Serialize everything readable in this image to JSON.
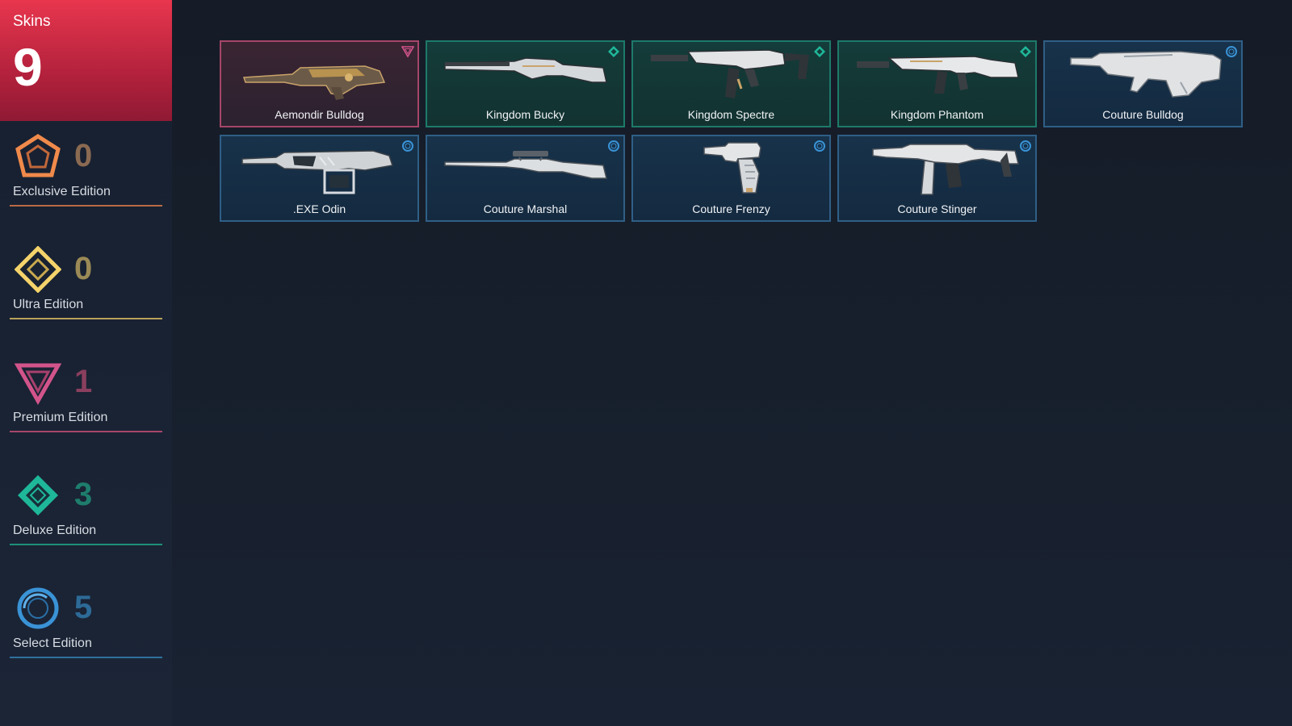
{
  "summary": {
    "label": "Skins",
    "total": "9"
  },
  "editions": [
    {
      "name": "Exclusive Edition",
      "count": "0",
      "icon": "exclusive-edition-icon",
      "color": "#f08a4b",
      "count_color": "#8a6a52"
    },
    {
      "name": "Ultra Edition",
      "count": "0",
      "icon": "ultra-edition-icon",
      "color": "#f5d36b",
      "count_color": "#9b8a56"
    },
    {
      "name": "Premium Edition",
      "count": "1",
      "icon": "premium-edition-icon",
      "color": "#d2548b",
      "count_color": "#8a3f5e"
    },
    {
      "name": "Deluxe Edition",
      "count": "3",
      "icon": "deluxe-edition-icon",
      "color": "#1fb79a",
      "count_color": "#1e7d6c"
    },
    {
      "name": "Select Edition",
      "count": "5",
      "icon": "select-edition-icon",
      "color": "#3a93d6",
      "count_color": "#2d6a97"
    }
  ],
  "skins": [
    {
      "name": "Aemondir Bulldog",
      "tier": "premium",
      "weapon": "bulldog"
    },
    {
      "name": "Kingdom Bucky",
      "tier": "deluxe",
      "weapon": "bucky"
    },
    {
      "name": "Kingdom Spectre",
      "tier": "deluxe",
      "weapon": "spectre"
    },
    {
      "name": "Kingdom Phantom",
      "tier": "deluxe",
      "weapon": "phantom"
    },
    {
      "name": "Couture Bulldog",
      "tier": "select",
      "weapon": "bulldog-compact"
    },
    {
      "name": ".EXE Odin",
      "tier": "select",
      "weapon": "odin"
    },
    {
      "name": "Couture Marshal",
      "tier": "select",
      "weapon": "marshal"
    },
    {
      "name": "Couture Frenzy",
      "tier": "select",
      "weapon": "frenzy"
    },
    {
      "name": "Couture Stinger",
      "tier": "select",
      "weapon": "stinger"
    }
  ],
  "colors": {
    "accent": "#e8364e",
    "premium": "#d2548b",
    "deluxe": "#1fb79a",
    "select": "#3a93d6"
  }
}
